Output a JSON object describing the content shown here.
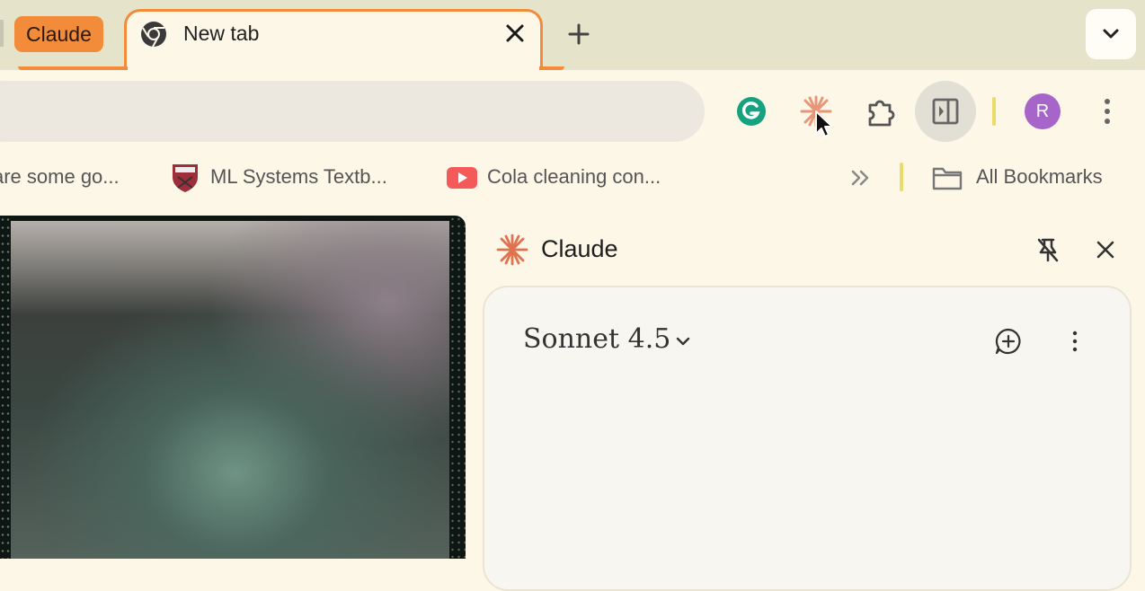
{
  "tab_group": {
    "label": "Claude",
    "color": "#f28b3a"
  },
  "active_tab": {
    "title": "New tab"
  },
  "toolbar": {
    "extensions": [
      "grammarly-icon",
      "claude-icon",
      "puzzle-icon"
    ],
    "avatar_initial": "R",
    "avatar_color": "#a865c9"
  },
  "bookmarks": {
    "items": [
      {
        "label": "are some go...",
        "icon": "document-icon"
      },
      {
        "label": "ML Systems Textb...",
        "icon": "harvard-shield-icon"
      },
      {
        "label": "Cola cleaning con...",
        "icon": "youtube-icon"
      }
    ],
    "overflow_icon": "double-chevron-right-icon",
    "all_bookmarks_label": "All Bookmarks"
  },
  "side_panel": {
    "title": "Claude",
    "model": "Sonnet 4.5",
    "brand_color": "#e0734f"
  }
}
